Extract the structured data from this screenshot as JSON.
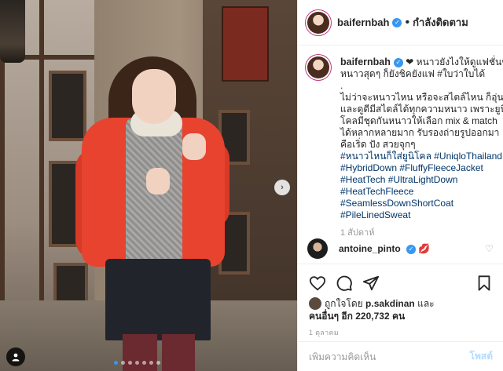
{
  "post": {
    "username": "baifernbah",
    "follow_label": "กำลังติดตาม",
    "separator": "•",
    "caption_lines": [
      "หนาวยังไงให้ดูแฟชั่นชิค",
      "หนาวสุดๆ ก็ยังชิคยังแฟ #ใบว่าใบได้",
      ".",
      "ไม่ว่าจะหนาวไหน หรือจะสไตล์ไหน ก็อุ่น",
      "และดูดีมีสไตล์ได้ทุกความหนาว เพราะยูนิ",
      "โคลมีชุดกันหนาวให้เลือก mix & match",
      "ได้หลากหลายมาก รับรองถ่ายรูปออกมา",
      "คือเริ่ด ปัง สวยจุกๆ"
    ],
    "hashtags": [
      "#หนาวไหนก็ใส่ยูนิโคล #UniqloThailand",
      "#HybridDown #FluffyFleeceJacket",
      "#HeatTech #UltraLightDown",
      "#HeatTechFleece",
      "#SeamlessDownShortCoat",
      "#PileLinedSweat"
    ],
    "caption_time": "1 สัปดาห์",
    "comments": [
      {
        "username": "antoine_pinto",
        "text": "💋"
      }
    ],
    "likes": {
      "prefix": "ถูกใจโดย",
      "first_user": "p.sakdinan",
      "and": "และ",
      "others_label": "คนอื่นๆ อีก",
      "count": "220,732",
      "unit": "คน"
    },
    "date": "1 ตุลาคม",
    "add_comment_placeholder": "เพิ่มความคิดเห็น",
    "post_button": "โพสต์"
  },
  "carousel": {
    "total": 7,
    "active": 0
  },
  "colors": {
    "accent": "#3897f0",
    "link": "#003569",
    "jacket": "#e8432f"
  },
  "icons": [
    "heart-icon",
    "comment-icon",
    "share-icon",
    "bookmark-icon",
    "tag-people-icon",
    "chevron-right-icon",
    "verified-icon"
  ]
}
